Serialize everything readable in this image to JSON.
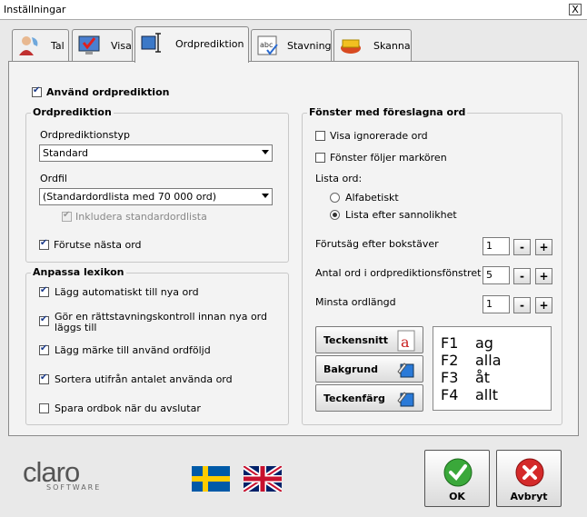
{
  "window": {
    "title": "Inställningar",
    "close_label": "X"
  },
  "tabs": [
    {
      "label": "Tal"
    },
    {
      "label": "Visa"
    },
    {
      "label": "Ordprediktion"
    },
    {
      "label": "Stavning"
    },
    {
      "label": "Skanna"
    }
  ],
  "use_prediction": {
    "label": "Använd ordprediktion",
    "checked": true
  },
  "ordprediktion": {
    "title": "Ordprediktion",
    "type_label": "Ordprediktionstyp",
    "type_value": "Standard",
    "file_label": "Ordfil",
    "file_value": "(Standardordlista med 70 000 ord)",
    "include_label": "Inkludera standardordlista",
    "predict_next_label": "Förutse nästa ord"
  },
  "lexikon": {
    "title": "Anpassa lexikon",
    "items": [
      {
        "label": "Lägg automatiskt till nya ord",
        "checked": true
      },
      {
        "label": "Gör en rättstavningskontroll innan nya ord",
        "label2": "läggs till",
        "checked": true
      },
      {
        "label": "Lägg märke till använd ordföljd",
        "checked": true
      },
      {
        "label": "Sortera utifrån antalet använda ord",
        "checked": true
      },
      {
        "label": "Spara ordbok när du avslutar",
        "checked": false
      }
    ]
  },
  "fonster": {
    "title": "Fönster med föreslagna ord",
    "show_ignored": "Visa ignorerade ord",
    "follow_cursor": "Fönster följer markören",
    "list_label": "Lista ord:",
    "alpha": "Alfabetiskt",
    "probability": "Lista efter sannolikhet",
    "predict_after_label": "Förutsäg efter bokstäver",
    "predict_after_value": "1",
    "word_count_label": "Antal ord i ordprediktionsfönstret",
    "word_count_value": "5",
    "min_length_label": "Minsta ordlängd",
    "min_length_value": "1",
    "minus": "-",
    "plus": "+",
    "font_button": "Teckensnitt",
    "bg_button": "Bakgrund",
    "color_button": "Teckenfärg",
    "preview": [
      {
        "key": "F1",
        "word": "ag"
      },
      {
        "key": "F2",
        "word": "alla"
      },
      {
        "key": "F3",
        "word": "åt"
      },
      {
        "key": "F4",
        "word": "allt"
      }
    ]
  },
  "footer": {
    "logo_text": "claro",
    "logo_sub": "SOFTWARE",
    "ok_label": "OK",
    "cancel_label": "Avbryt"
  },
  "colors": {
    "accent": "#1a3a8a",
    "ok_green": "#3aa83a",
    "cancel_red": "#d42a2a",
    "swedish_blue": "#005aa8",
    "swedish_yellow": "#fecc00"
  }
}
